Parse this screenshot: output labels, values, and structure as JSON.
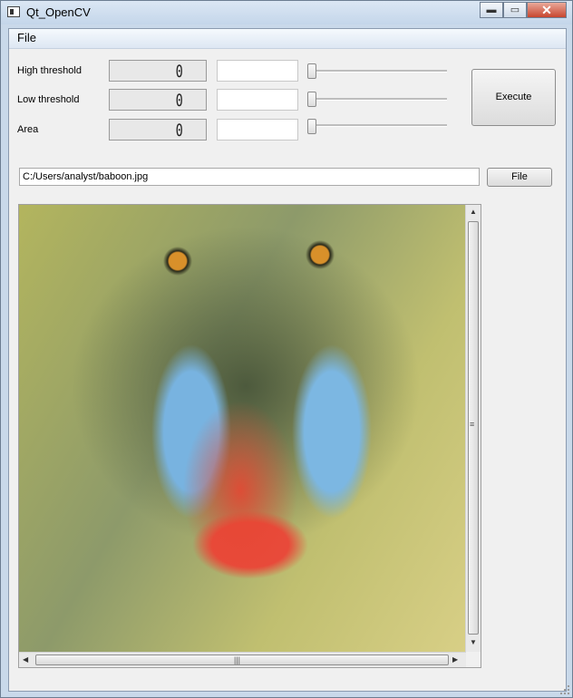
{
  "window": {
    "title": "Qt_OpenCV",
    "buttons": {
      "minimize": "▬",
      "maximize": "▭",
      "close": "✕"
    }
  },
  "menubar": {
    "file": "File"
  },
  "controls": [
    {
      "label": "High threshold",
      "lcd_value": "0",
      "slider_value": 0
    },
    {
      "label": "Low threshold",
      "lcd_value": "0",
      "slider_value": 0
    },
    {
      "label": "Area",
      "lcd_value": "0",
      "slider_value": 0
    }
  ],
  "execute_label": "Execute",
  "file_path": "C:/Users/analyst/baboon.jpg",
  "file_button_label": "File",
  "image_view": {
    "image": "baboon face with edge overlay"
  },
  "scrollbars": {
    "grip": "≡",
    "hgrip": "|||",
    "up": "▲",
    "down": "▼",
    "left": "◀",
    "right": "▶"
  }
}
